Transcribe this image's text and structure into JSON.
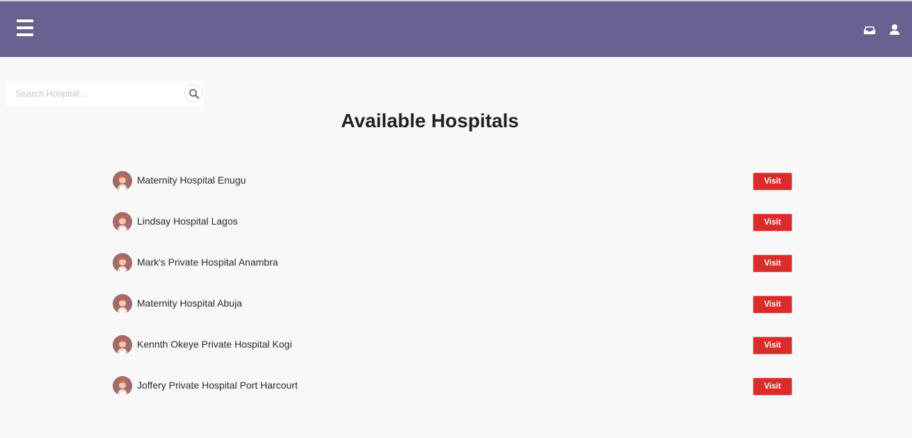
{
  "colors": {
    "navbar": "#6b6191",
    "page_background": "#f8f8f8",
    "visit_button": "#dc2b2b",
    "title_text": "#222222"
  },
  "header": {
    "menu_icon": "hamburger-menu-icon",
    "right_icons": [
      "inbox-icon",
      "user-icon"
    ]
  },
  "search": {
    "placeholder": "Search Hospital...",
    "value": "",
    "icon": "search-icon"
  },
  "main": {
    "title": "Available Hospitals",
    "hospitals": [
      {
        "name": "Maternity Hospital Enugu",
        "action_label": "Visit"
      },
      {
        "name": "Lindsay Hospital Lagos",
        "action_label": "Visit"
      },
      {
        "name": "Mark's Private Hospital Anambra",
        "action_label": "Visit"
      },
      {
        "name": "Maternity Hospital Abuja",
        "action_label": "Visit"
      },
      {
        "name": "Kennth Okeye Private Hospital Kogi",
        "action_label": "Visit"
      },
      {
        "name": "Joffery Private Hospital Port Harcourt",
        "action_label": "Visit"
      }
    ]
  }
}
